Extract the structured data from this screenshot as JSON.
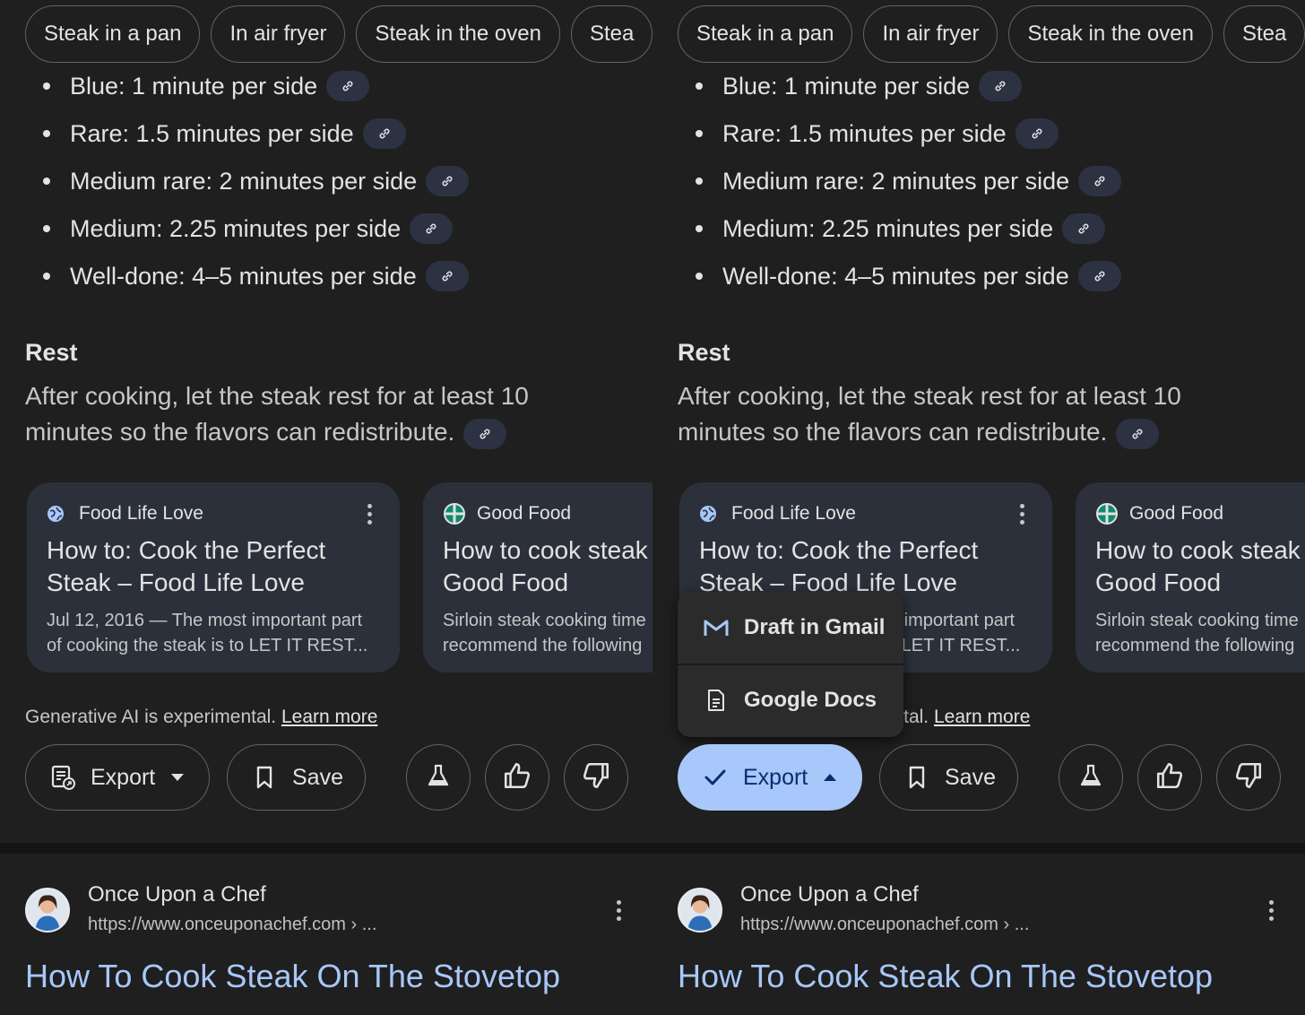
{
  "chips": [
    "Steak in a pan",
    "In air fryer",
    "Steak in the oven",
    "Stea"
  ],
  "bullets": [
    "Blue: 1 minute per side",
    "Rare: 1.5 minutes per side",
    "Medium rare: 2 minutes per side",
    "Medium: 2.25 minutes per side",
    "Well-done: 4–5 minutes per side"
  ],
  "rest": {
    "heading": "Rest",
    "body": "After cooking, let the steak rest for at least 10 minutes so the flavors can redistribute."
  },
  "cards": [
    {
      "source": "Food Life Love",
      "title_line1": "How to: Cook the Perfect",
      "title_line2": "Steak – Food Life Love",
      "snippet_line1": "Jul 12, 2016 — The most important part",
      "snippet_line2": "of cooking the steak is to LET IT REST..."
    },
    {
      "source": "Good Food",
      "title_line1": "How to cook steak",
      "title_line2": "Good Food",
      "snippet_line1": "Sirloin steak cooking time",
      "snippet_line2": "recommend the following"
    }
  ],
  "disclaimer": {
    "text": "Generative AI is experimental. ",
    "link": "Learn more"
  },
  "actions": {
    "export_label": "Export",
    "save_label": "Save"
  },
  "menu": {
    "gmail": "Draft in Gmail",
    "docs": "Google Docs"
  },
  "result": {
    "site": "Once Upon a Chef",
    "url": "https://www.onceuponachef.com › ...",
    "title": "How To Cook Steak On The Stovetop"
  },
  "colors": {
    "background": "#1f1f1f",
    "card": "#2b303b",
    "accent": "#a8c7fa",
    "link_chip": "#2c3242"
  },
  "icons": [
    "link-icon",
    "globe-icon",
    "good-food-icon",
    "kebab-icon",
    "export-doc-icon",
    "check-icon",
    "bookmark-icon",
    "flask-icon",
    "thumbs-up-icon",
    "thumbs-down-icon",
    "gmail-icon",
    "docs-icon",
    "avatar-icon"
  ]
}
